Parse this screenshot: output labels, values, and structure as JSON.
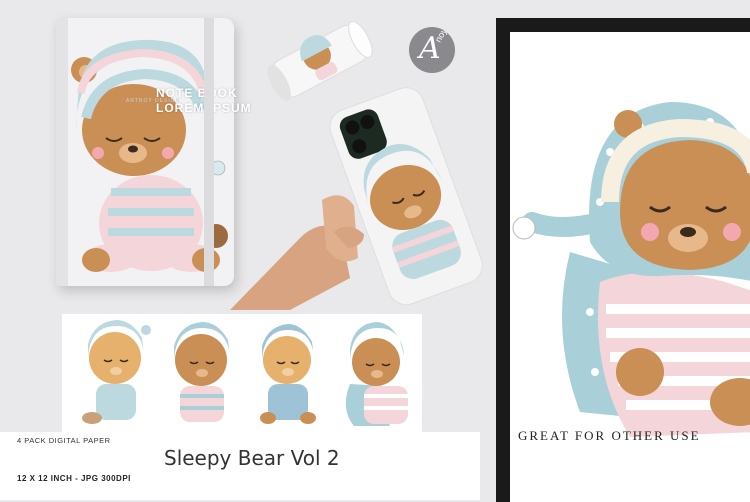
{
  "notebook": {
    "title_line1": "NOTE BOOK",
    "title_line2": "LOREM IPSUM",
    "subtitle": "ARTNOY DESIGN"
  },
  "logo": {
    "letter": "A",
    "word": "noy"
  },
  "poster": {
    "caption": "GREAT FOR OTHER USE"
  },
  "banner": {
    "top": "4 PACK DIGITAL PAPER",
    "title": "Sleepy Bear Vol 2",
    "bottom": "12 X 12 INCH - JPG 300DPI"
  },
  "colors": {
    "bear_fur": "#c98f55",
    "hood_blue": "#a9cfd9",
    "stripe_pink": "#f3c9cf",
    "frame": "#1a1a1a"
  }
}
